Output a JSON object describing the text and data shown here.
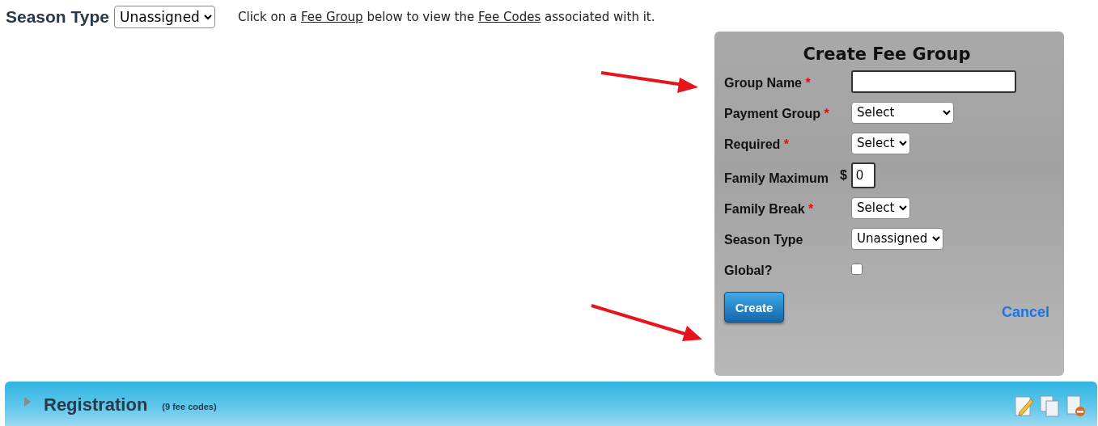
{
  "header": {
    "label": "Season Type",
    "season_select": "Unassigned",
    "hint": {
      "before": "Click on a ",
      "link1": "Fee Group",
      "middle": " below to view the ",
      "link2": "Fee Codes",
      "after": " associated with it."
    }
  },
  "dialog": {
    "title": "Create Fee Group",
    "fields": [
      {
        "label": "Group Name",
        "required_mark": "*",
        "kind": "text"
      },
      {
        "label": "Payment Group",
        "required_mark": "*",
        "kind": "select",
        "value": "Select"
      },
      {
        "label": "Required",
        "required_mark": "*",
        "kind": "select",
        "value": "Select"
      },
      {
        "label": "Family Maximum",
        "kind": "money",
        "prefix": "$",
        "value": "0"
      },
      {
        "label": "Family Break",
        "required_mark": "*",
        "kind": "select",
        "value": "Select"
      },
      {
        "label": "Season Type",
        "kind": "select",
        "value": "Unassigned"
      },
      {
        "label": "Global?",
        "kind": "checkbox",
        "checked": false
      }
    ],
    "create": "Create",
    "cancel": "Cancel"
  },
  "group_bar": {
    "name": "Registration",
    "count": "(9 fee codes)",
    "expanded": false
  }
}
